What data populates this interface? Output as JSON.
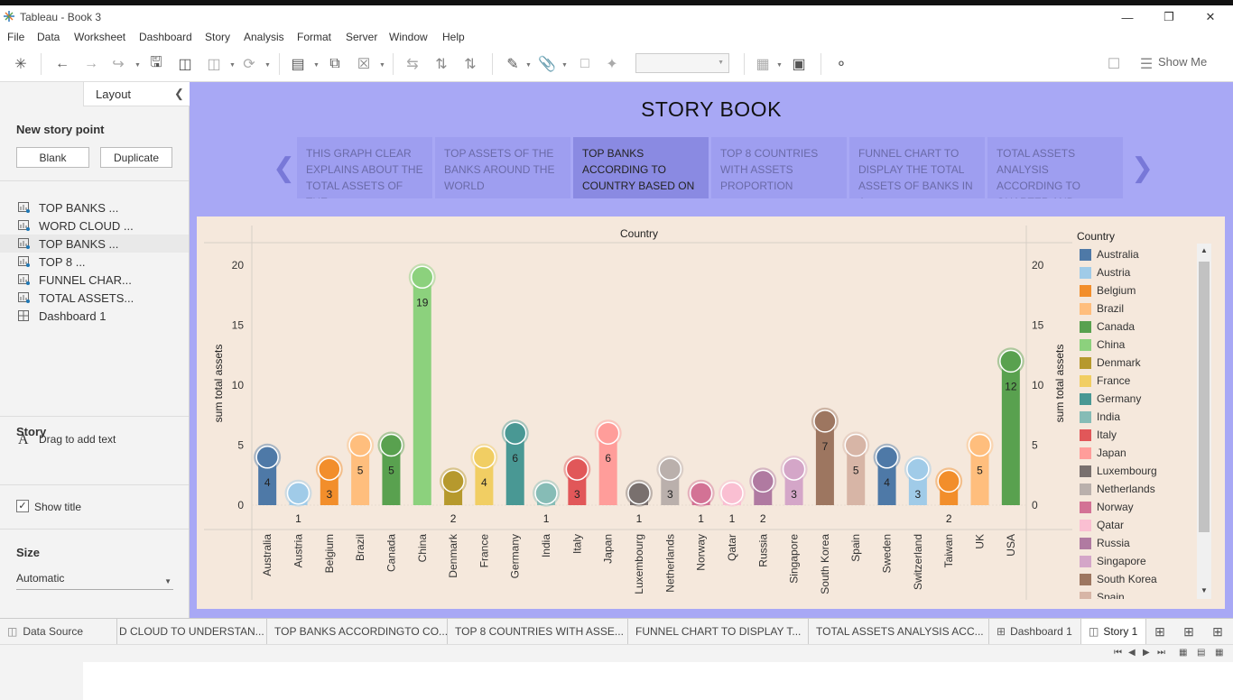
{
  "window": {
    "title": "Tableau - Book 3"
  },
  "menu": [
    "File",
    "Data",
    "Worksheet",
    "Dashboard",
    "Story",
    "Analysis",
    "Format",
    "Server",
    "Window",
    "Help"
  ],
  "toolbar": {
    "show_me": "Show Me"
  },
  "left_panel": {
    "tab_story": "Story",
    "tab_layout": "Layout",
    "new_story_point": "New story point",
    "blank": "Blank",
    "duplicate": "Duplicate",
    "sheets": [
      "TOP BANKS ...",
      "WORD CLOUD ...",
      "TOP BANKS ...",
      "TOP 8 ...",
      "FUNNEL CHAR...",
      "TOTAL ASSETS...",
      "Dashboard 1"
    ],
    "drag_text": "Drag to add text",
    "show_title": "Show title",
    "size_label": "Size",
    "size_value": "Automatic"
  },
  "story": {
    "title": "STORY BOOK",
    "points": [
      "THIS GRAPH CLEAR EXPLAINS ABOUT THE TOTAL ASSETS OF THE",
      "TOP ASSETS OF THE BANKS AROUND THE WORLD",
      "TOP BANKS ACCORDING TO COUNTRY BASED ON",
      "TOP 8 COUNTRIES WITH ASSETS PROPORTION",
      "FUNNEL CHART TO DISPLAY THE TOTAL ASSETS OF BANKS IN A",
      "TOTAL ASSETS ANALYSIS ACCORDING TO QUARTER AND"
    ],
    "active_point": 2
  },
  "chart_data": {
    "type": "bar",
    "title": "Country",
    "xlabel": "",
    "ylabel": "sum total assets",
    "ylim": [
      0,
      22
    ],
    "yticks": [
      0,
      5,
      10,
      15,
      20
    ],
    "categories": [
      "Australia",
      "Austria",
      "Belgium",
      "Brazil",
      "Canada",
      "China",
      "Denmark",
      "France",
      "Germany",
      "India",
      "Italy",
      "Japan",
      "Luxembourg",
      "Netherlands",
      "Norway",
      "Qatar",
      "Russia",
      "Singapore",
      "South Korea",
      "Spain",
      "Sweden",
      "Switzerland",
      "Taiwan",
      "UK",
      "USA"
    ],
    "values": [
      4,
      1,
      3,
      5,
      5,
      19,
      2,
      4,
      6,
      1,
      3,
      6,
      1,
      3,
      1,
      1,
      2,
      3,
      7,
      5,
      4,
      3,
      2,
      5,
      12
    ],
    "colors": [
      "#4e79a7",
      "#a0cbe8",
      "#f28e2b",
      "#ffbe7d",
      "#59a14f",
      "#8cd17d",
      "#b6992d",
      "#f1ce63",
      "#499894",
      "#86bcb6",
      "#e15759",
      "#ff9d9a",
      "#79706e",
      "#bab0ac",
      "#d37295",
      "#fabfd2",
      "#b07aa1",
      "#d4a6c8",
      "#9d7660",
      "#d7b5a6",
      "#4e79a7",
      "#a0cbe8",
      "#f28e2b",
      "#ffbe7d",
      "#59a14f"
    ],
    "grid": false,
    "legend_position": "right"
  },
  "legend": {
    "title": "Country",
    "items": [
      "Australia",
      "Austria",
      "Belgium",
      "Brazil",
      "Canada",
      "China",
      "Denmark",
      "France",
      "Germany",
      "India",
      "Italy",
      "Japan",
      "Luxembourg",
      "Netherlands",
      "Norway",
      "Qatar",
      "Russia",
      "Singapore",
      "South Korea",
      "Spain"
    ]
  },
  "tabs": {
    "data_source": "Data Source",
    "sheets": [
      "D CLOUD TO UNDERSTAN...",
      "TOP BANKS ACCORDINGTO CO...",
      "TOP 8 COUNTRIES WITH ASSE...",
      "FUNNEL CHART TO DISPLAY T...",
      "TOTAL ASSETS ANALYSIS ACC...",
      "Dashboard 1",
      "Story 1"
    ]
  }
}
